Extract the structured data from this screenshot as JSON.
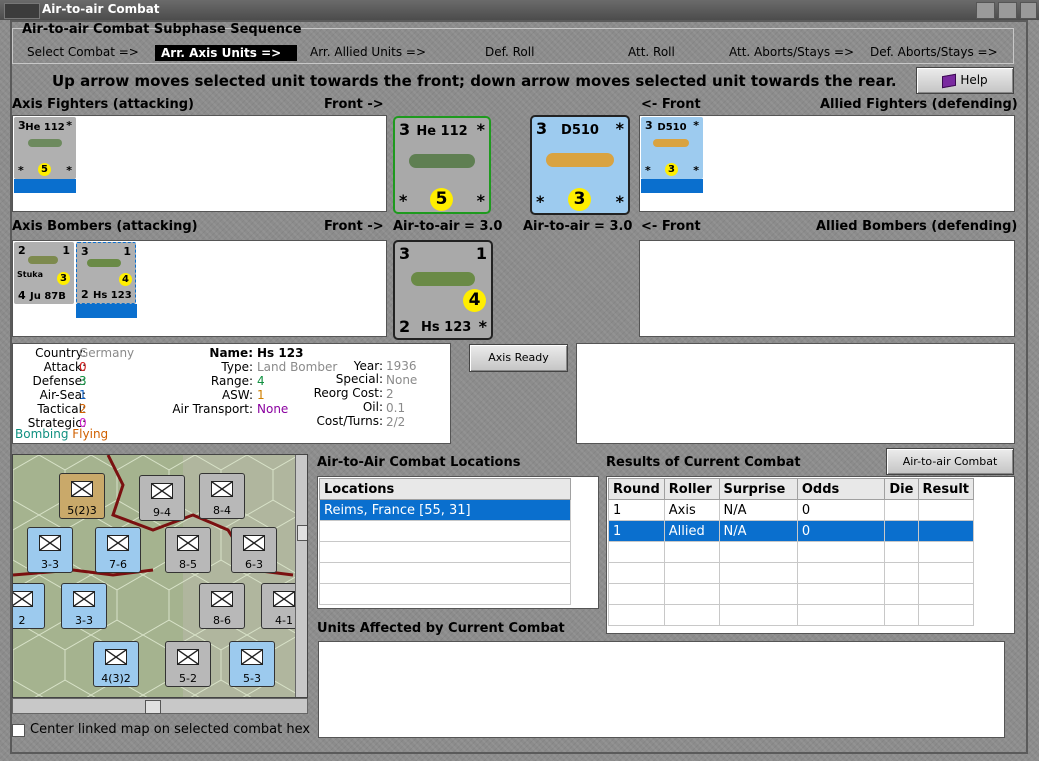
{
  "window": {
    "title": "Air-to-air Combat"
  },
  "sequence": {
    "title": "Air-to-air Combat Subphase Sequence",
    "steps": [
      "Select Combat =>",
      "Arr. Axis Units =>",
      "Arr. Allied Units =>",
      "Def. Roll",
      "Att. Roll",
      "Att. Aborts/Stays =>",
      "Def. Aborts/Stays =>"
    ],
    "active_index": 1
  },
  "instruction": "Up arrow moves selected unit towards the front; down arrow moves selected unit towards the rear.",
  "help_button": "Help",
  "labels": {
    "axis_fighters": "Axis Fighters (attacking)",
    "front_right": "Front ->",
    "front_left": "<- Front",
    "allied_fighters": "Allied Fighters (defending)",
    "axis_bombers": "Axis Bombers (attacking)",
    "allied_bombers": "Allied Bombers (defending)",
    "axis_a2a": "Air-to-air = 3.0",
    "allied_a2a": "Air-to-air = 3.0"
  },
  "units": {
    "he112": {
      "name": "He 112",
      "top": "3",
      "val": "5",
      "color": "#a8a8a8"
    },
    "d510": {
      "name": "D510",
      "top": "3",
      "val": "3",
      "color": "#9ccaee"
    },
    "ju87b": {
      "name": "Ju 87B",
      "tl": "2",
      "tr": "1",
      "bl": "4",
      "val": "3",
      "tag": "Stuka"
    },
    "hs123": {
      "name": "Hs 123",
      "tl": "3",
      "tr": "1",
      "bl": "2",
      "val": "4"
    }
  },
  "axis_ready_button": "Axis Ready",
  "unit_info": {
    "country_k": "Country:",
    "country_v": "Germany",
    "attack_k": "Attack:",
    "attack_v": "0",
    "defense_k": "Defense:",
    "defense_v": "3",
    "airsea_k": "Air-Sea:",
    "airsea_v": "1",
    "tactical_k": "Tactical:",
    "tactical_v": "2",
    "strategic_k": "Strategic:",
    "strategic_v": "0",
    "bombing": "Bombing",
    "flying": "Flying",
    "name_k": "Name:",
    "name_v": "Hs 123",
    "type_k": "Type:",
    "type_v": "Land Bomber",
    "range_k": "Range:",
    "range_v": "4",
    "asw_k": "ASW:",
    "asw_v": "1",
    "airtrans_k": "Air Transport:",
    "airtrans_v": "None",
    "year_k": "Year:",
    "year_v": "1936",
    "special_k": "Special:",
    "special_v": "None",
    "reorg_k": "Reorg Cost:",
    "reorg_v": "2",
    "oil_k": "Oil:",
    "oil_v": "0.1",
    "cost_k": "Cost/Turns:",
    "cost_v": "2/2"
  },
  "locations": {
    "title": "Air-to-Air Combat Locations",
    "header": "Locations",
    "rows": [
      "Reims, France [55, 31]"
    ]
  },
  "results": {
    "title": "Results of Current Combat",
    "chart_button": "Air-to-air Combat Chart",
    "headers": [
      "Round",
      "Roller",
      "Surprise",
      "Odds",
      "Die",
      "Result"
    ],
    "rows": [
      [
        "1",
        "Axis",
        "N/A",
        "0",
        "",
        ""
      ],
      [
        "1",
        "Allied",
        "N/A",
        "0",
        "",
        ""
      ]
    ]
  },
  "affected": {
    "title": "Units Affected by Current Combat"
  },
  "center_map_checkbox": "Center linked map on selected combat hex",
  "map_units": [
    {
      "label": "5(2)3",
      "kind": "xxxx"
    },
    {
      "label": "9-4",
      "kind": "xxx"
    },
    {
      "label": "8-4",
      "kind": "xxx"
    },
    {
      "label": "3-3",
      "kind": "xxx"
    },
    {
      "label": "7-6",
      "kind": "xxx"
    },
    {
      "label": "8-5",
      "kind": "xxx"
    },
    {
      "label": "6-3",
      "kind": "xxx"
    },
    {
      "label": "3-3",
      "kind": "xxx"
    },
    {
      "label": "8-6",
      "kind": "xxx"
    },
    {
      "label": "4-1",
      "kind": "xxx"
    },
    {
      "label": "4(3)2",
      "kind": "xxxxx"
    },
    {
      "label": "5-2",
      "kind": "xxx"
    },
    {
      "label": "5-3",
      "kind": "xxx"
    },
    {
      "label": "2",
      "kind": "xxx"
    }
  ]
}
